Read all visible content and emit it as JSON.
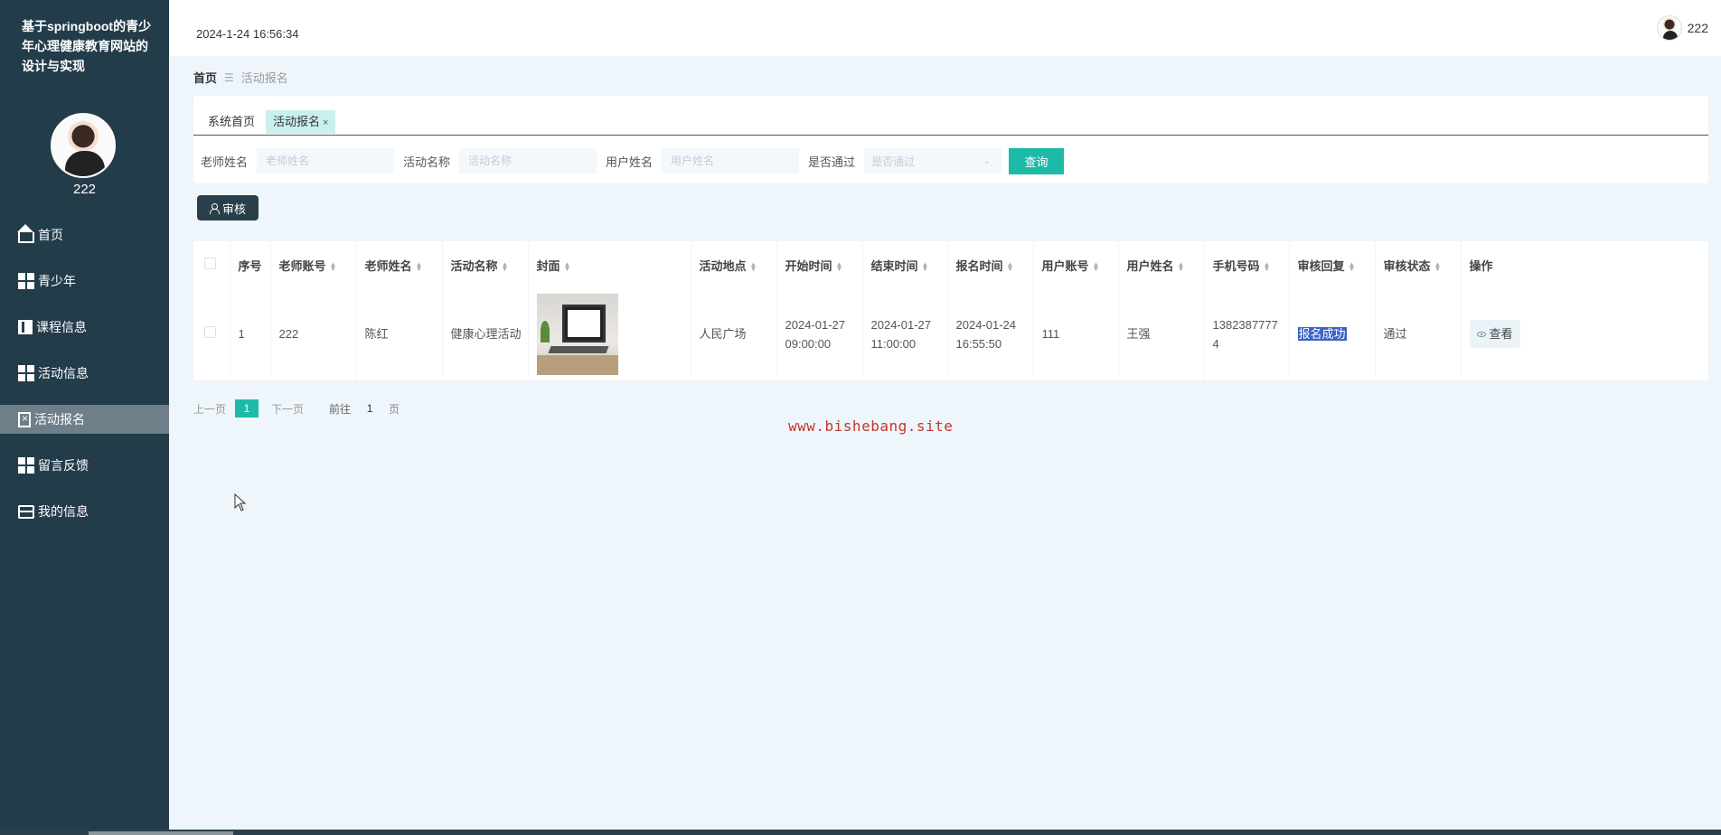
{
  "app": {
    "site_title": "基于springboot的青少年心理健康教育网站的设计与实现",
    "username": "222"
  },
  "topbar": {
    "datetime": "2024-1-24 16:56:34",
    "username": "222"
  },
  "sidebar": {
    "items": [
      {
        "label": "首页",
        "icon": "home-icon"
      },
      {
        "label": "青少年",
        "icon": "grid-icon"
      },
      {
        "label": "课程信息",
        "icon": "book-icon"
      },
      {
        "label": "活动信息",
        "icon": "grid-icon"
      },
      {
        "label": "活动报名",
        "icon": "clipboard-icon",
        "active": true
      },
      {
        "label": "留言反馈",
        "icon": "grid-icon"
      },
      {
        "label": "我的信息",
        "icon": "card-icon"
      }
    ]
  },
  "breadcrumb": {
    "home": "首页",
    "current": "活动报名"
  },
  "tabs": {
    "home": "系统首页",
    "active": "活动报名",
    "close": "×"
  },
  "search": {
    "teacher_name_label": "老师姓名",
    "teacher_name_placeholder": "老师姓名",
    "activity_name_label": "活动名称",
    "activity_name_placeholder": "活动名称",
    "user_name_label": "用户姓名",
    "user_name_placeholder": "用户姓名",
    "passed_label": "是否通过",
    "passed_placeholder": "是否通过",
    "query_button": "查询"
  },
  "actions": {
    "review_button": "审核"
  },
  "table": {
    "columns": [
      "序号",
      "老师账号",
      "老师姓名",
      "活动名称",
      "封面",
      "活动地点",
      "开始时间",
      "结束时间",
      "报名时间",
      "用户账号",
      "用户姓名",
      "手机号码",
      "审核回复",
      "审核状态",
      "操作"
    ],
    "rows": [
      {
        "index": "1",
        "teacher_account": "222",
        "teacher_name": "陈红",
        "activity_name": "健康心理活动",
        "location": "人民广场",
        "start_time": "2024-01-27 09:00:00",
        "end_time": "2024-01-27 11:00:00",
        "signup_time": "2024-01-24 16:55:50",
        "user_account": "111",
        "user_name": "王强",
        "phone": "13823877774",
        "review_reply": "报名成功",
        "review_status": "通过",
        "view_button": "查看"
      }
    ]
  },
  "pagination": {
    "prev": "上一页",
    "current": "1",
    "next": "下一页",
    "goto": "前往",
    "goto_value": "1",
    "page_unit": "页"
  },
  "watermark": "www.bishebang.site",
  "colors": {
    "sidebar_bg": "#233c4a",
    "accent": "#1cbba8",
    "page_bg": "#eef5fb"
  }
}
